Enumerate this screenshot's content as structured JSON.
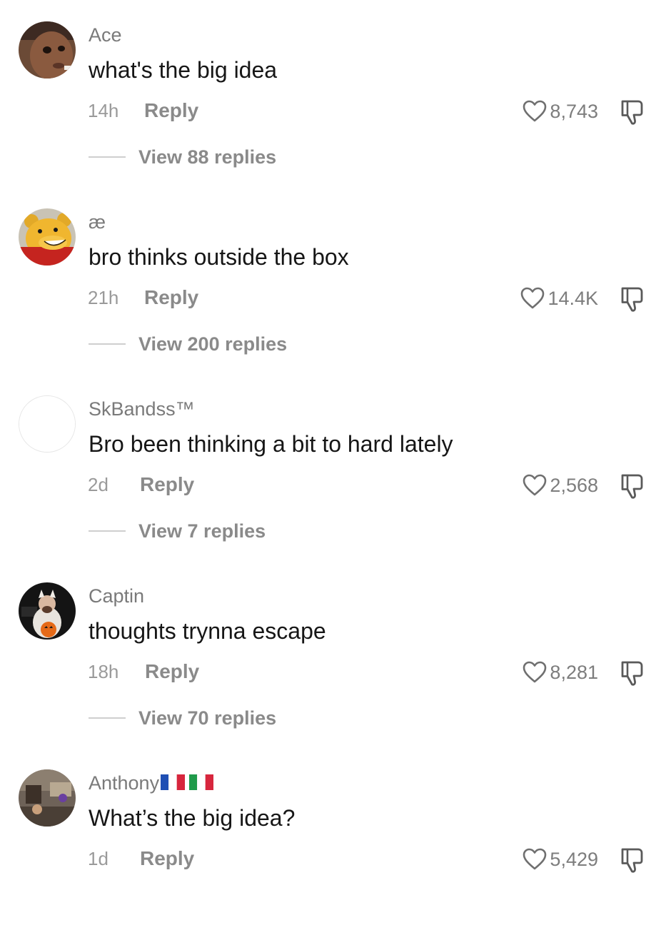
{
  "comments": [
    {
      "username": "Ace",
      "text": "what's the big idea",
      "time": "14h",
      "reply_label": "Reply",
      "likes": "8,743",
      "view_replies": "View 88 replies",
      "avatar_icon": "baby-photo-avatar"
    },
    {
      "username": "æ",
      "text": "bro thinks outside the box",
      "time": "21h",
      "reply_label": "Reply",
      "likes": "14.4K",
      "view_replies": "View 200 replies",
      "avatar_icon": "cartoon-bear-avatar"
    },
    {
      "username": "SkBandss™",
      "text": "Bro been thinking a bit to hard lately",
      "time": "2d",
      "reply_label": "Reply",
      "likes": "2,568",
      "view_replies": "View 7 replies",
      "avatar_icon": "blank-avatar"
    },
    {
      "username": "Captin",
      "text": "thoughts trynna escape",
      "time": "18h",
      "reply_label": "Reply",
      "likes": "8,281",
      "view_replies": "View 70 replies",
      "avatar_icon": "costume-photo-avatar"
    },
    {
      "username": "Anthony",
      "text": "What’s the big idea?",
      "time": "1d",
      "reply_label": "Reply",
      "likes": "5,429",
      "view_replies": "",
      "avatar_icon": "room-photo-avatar",
      "flags": [
        "france-flag",
        "italy-flag"
      ]
    }
  ],
  "colors": {
    "username": "#7a7a7a",
    "text": "#161616",
    "meta": "#9a9a9a",
    "action": "#8a8a8a"
  }
}
